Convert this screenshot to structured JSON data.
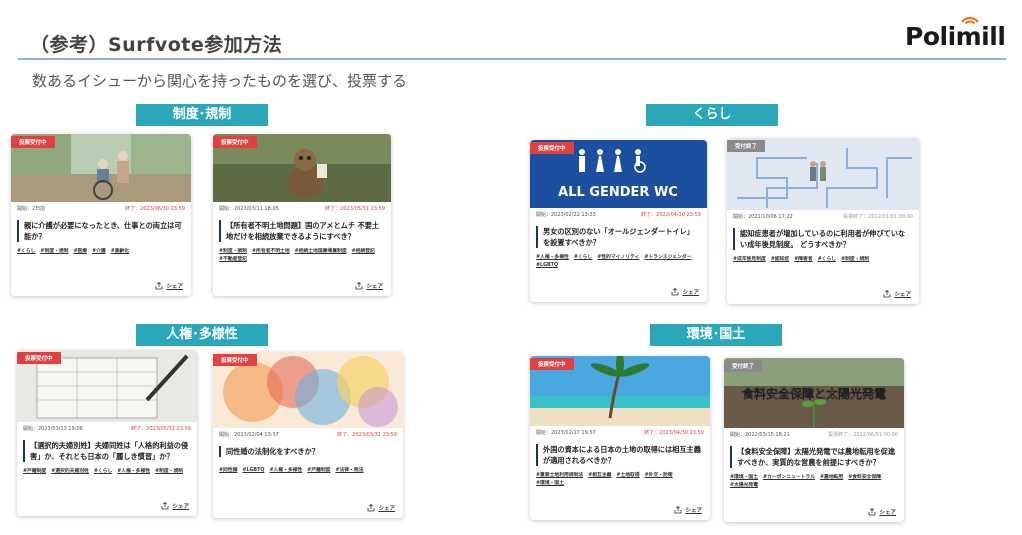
{
  "header": {
    "title": "（参考）Surfvote参加方法",
    "subtitle": "数あるイシューから関心を持ったものを選び、投票する",
    "logo": "Polimill"
  },
  "categories": {
    "c1": "制度･規制",
    "c2": "くらし",
    "c3": "人権･多様性",
    "c4": "環境･国土"
  },
  "share_label": "シェア",
  "cards": {
    "a": {
      "status": "投票受付中",
      "start": "開始：2日前",
      "end": "終了：2023/06/30 23:59",
      "question": "親に介護が必要になったとき、仕事との両立は可能か？",
      "tags": [
        "#くらし",
        "#制度・規制",
        "#医療",
        "#介護",
        "#高齢化"
      ]
    },
    "b": {
      "status": "投票受付中",
      "start": "開始：2023/03/11 18:05",
      "end": "終了：2023/05/31 23:59",
      "question": "【所有者不明土地問題】国のアメとムチ 不要土地だけを相続放棄できるようにすべき？",
      "tags": [
        "#制度・規制",
        "#所有者不明土地",
        "#相続土地国庫帰属制度",
        "#相続登記",
        "#不動産登記"
      ]
    },
    "c": {
      "status": "投票受付中",
      "start": "開始：2023/02/22 13:33",
      "end": "終了：2023/04/30 23:59",
      "question": "男女の区別のない「オールジェンダートイレ」を設置すべきか？",
      "tags": [
        "#人権・多様性",
        "#くらし",
        "#性的マイノリティ",
        "#トランスジェンダー",
        "#LGBTQ"
      ],
      "sign": "ALL GENDER WC"
    },
    "d": {
      "status": "受付終了",
      "start": "開始：2021/10/06 17:22",
      "end": "投票終了：2022/01/01 00:00",
      "question": "認知症患者が増加しているのに利用者が伸びていない成年後見制度。 どうすべきか？",
      "tags": [
        "#成年後見制度",
        "#認知症",
        "#障害者",
        "#くらし",
        "#制度・規制"
      ]
    },
    "e": {
      "status": "投票受付中",
      "start": "開始：2023/03/13 19:06",
      "end": "終了：2023/05/31 23:59",
      "question": "【選択的夫婦別姓】夫婦同姓は「人格的利益の侵害」か、それとも日本の「麗しき慣習」か？",
      "tags": [
        "#戸籍制度",
        "#選択的夫婦別姓",
        "#くらし",
        "#人権・多様性",
        "#制度・規制"
      ]
    },
    "f": {
      "status": "投票受付中",
      "start": "開始：2023/02/04 13:37",
      "end": "終了：2023/03/31 23:59",
      "question": "同性婚の法制化をすべきか？",
      "tags": [
        "#同性婚",
        "#LGBTQ",
        "#人権・多様性",
        "#戸籍制度",
        "#法律・税法"
      ]
    },
    "g": {
      "status": "投票受付中",
      "start": "開始：2023/02/17 19:57",
      "end": "終了：2023/04/30 23:59",
      "question": "外国の資本による日本の土地の取得には相互主義が適用されるべきか？",
      "tags": [
        "#重要土地利用規制法",
        "#相互主義",
        "#土地取得",
        "#外交・防衛",
        "#環境・国土"
      ]
    },
    "h": {
      "status": "受付終了",
      "start": "開始：2022/03/15 18:21",
      "end": "投票終了：2022/06/01 00:00",
      "question": "【食料安全保障】太陽光発電では農地転用を促進すべきか、実質的な営農を前提にすべきか？",
      "tags": [
        "#環境・国土",
        "#カーボンニュートラル",
        "#農地転用",
        "#食料安全保障",
        "#太陽光発電"
      ],
      "overlay": "食料安全保障と太陽光発電"
    }
  },
  "colors": {
    "accent": "#2aa7b8",
    "open": "#e04040",
    "closed": "#8a8a8a",
    "rule": "#8fb3d9"
  }
}
